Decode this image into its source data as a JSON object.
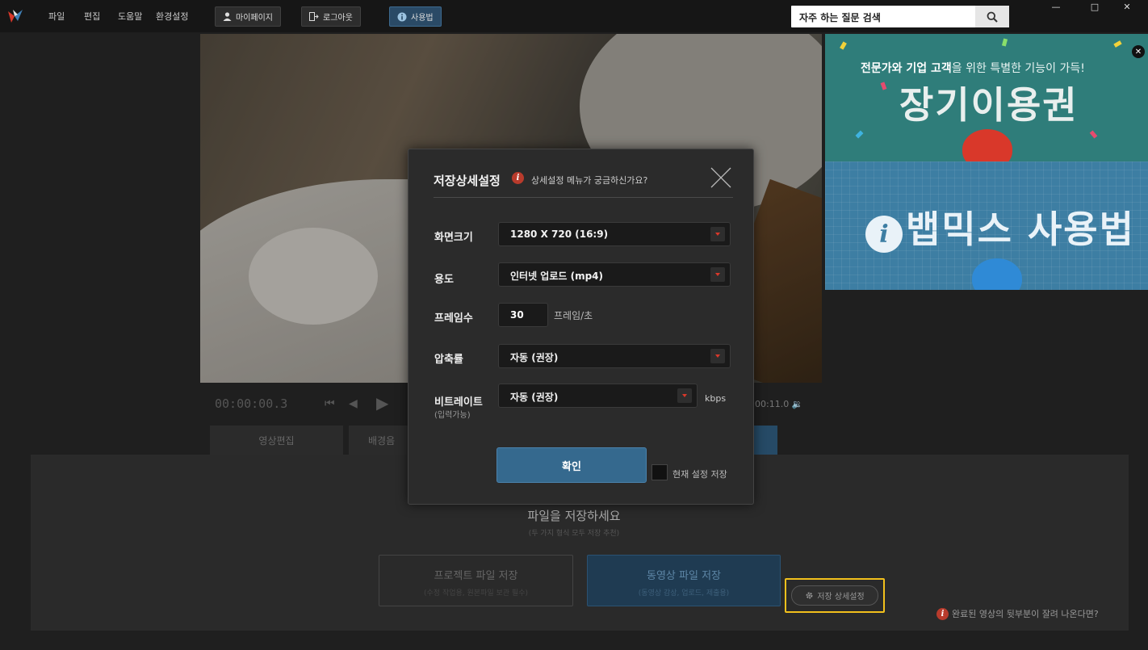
{
  "menu": {
    "file": "파일",
    "edit": "편집",
    "help": "도움말",
    "settings": "환경설정"
  },
  "toolbar": {
    "mypage": "마이페이지",
    "logout": "로그아웃",
    "usage": "사용법"
  },
  "search": {
    "placeholder": "자주 하는 질문 검색"
  },
  "player": {
    "timecode": "00:00:00.3",
    "end_time": "00:11.0"
  },
  "tabs": {
    "video_edit": "영상편집",
    "bgm": "배경음"
  },
  "ad": {
    "line1_bold": "전문가와 기업 고객",
    "line1_rest": "을 위한 특별한 기능이 가득!",
    "title_top": "장기이용권",
    "title_bottom": "뱁믹스 사용법"
  },
  "modal": {
    "title": "저장상세설정",
    "help_text": "상세설정 메뉴가 궁금하신가요?",
    "resolution_label": "화면크기",
    "resolution_value": "1280 X 720 (16:9)",
    "purpose_label": "용도",
    "purpose_value": "인터넷 업로드 (mp4)",
    "fps_label": "프레임수",
    "fps_value": "30",
    "fps_unit": "프레임/초",
    "compression_label": "압축률",
    "compression_value": "자동 (권장)",
    "bitrate_label": "비트레이트",
    "bitrate_sublabel": "(입력가능)",
    "bitrate_value": "자동 (권장)",
    "bitrate_unit": "kbps",
    "confirm_label": "확인",
    "save_settings_label": "현재 설정 저장"
  },
  "save": {
    "title": "파일을 저장하세요",
    "subtitle": "(두 가지 형식 모두 저장 추천)",
    "project_title": "프로젝트 파일 저장",
    "project_sub": "(수정 작업용, 원본파일 보관 필수)",
    "video_title": "동영상 파일 저장",
    "video_sub": "(동영상 감상, 업로드, 제출용)",
    "advanced_label": "저장 상세설정",
    "help_link": "완료된 영상의 뒷부분이 잘려 나온다면?"
  },
  "colors": {
    "accent": "#35698e",
    "highlight": "#f2c01c",
    "info_red": "#b83b2c"
  }
}
